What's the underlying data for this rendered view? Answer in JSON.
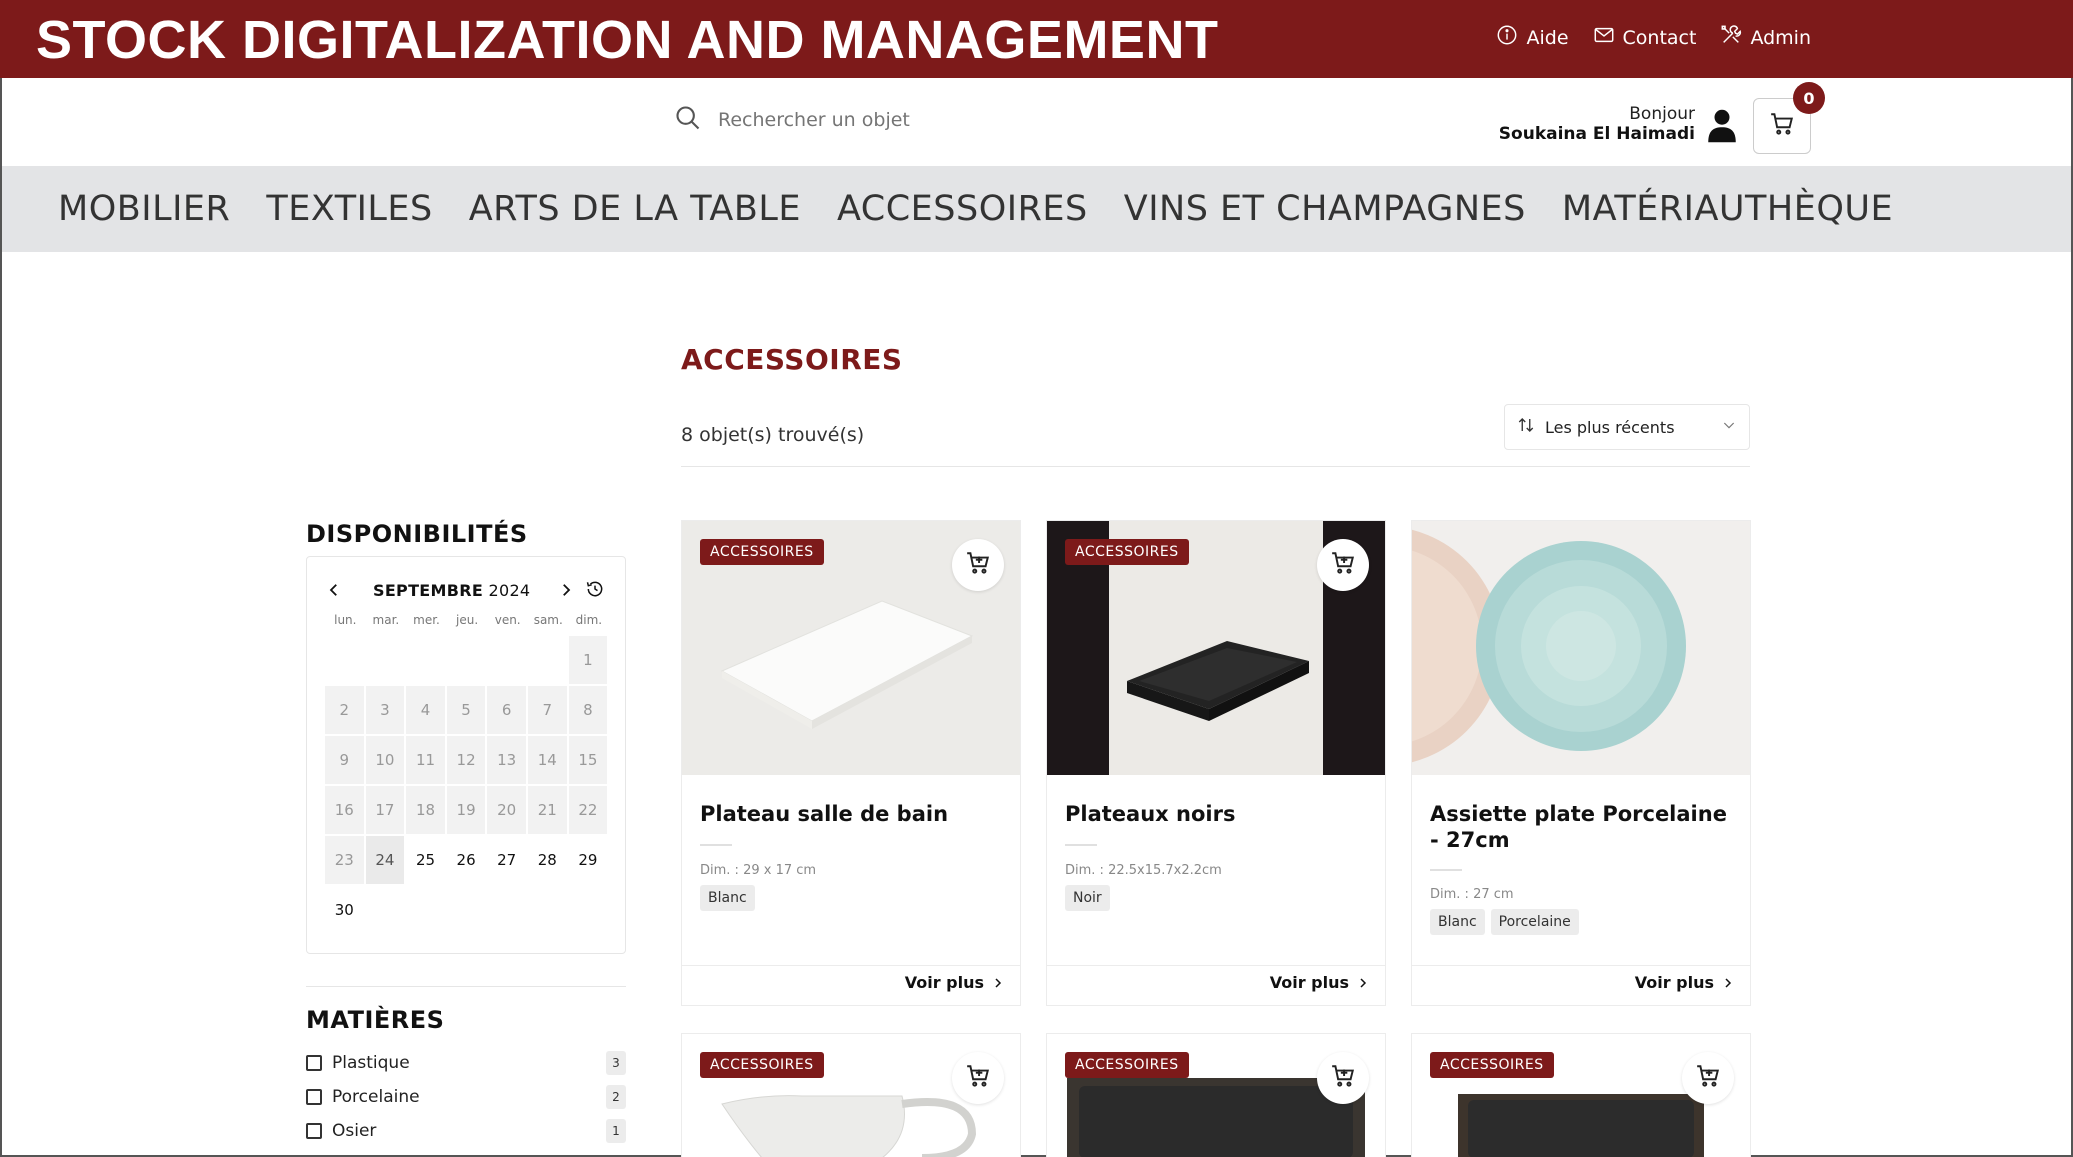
{
  "header": {
    "brand": "STOCK DIGITALIZATION AND MANAGEMENT",
    "links": [
      {
        "label": "Aide",
        "icon": "info-icon"
      },
      {
        "label": "Contact",
        "icon": "mail-icon"
      },
      {
        "label": "Admin",
        "icon": "tools-icon"
      }
    ]
  },
  "search": {
    "placeholder": "Rechercher un objet"
  },
  "user": {
    "greeting": "Bonjour",
    "name": "Soukaina El Haimadi"
  },
  "cart": {
    "count": "0"
  },
  "categories": [
    "MOBILIER",
    "TEXTILES",
    "ARTS DE LA TABLE",
    "ACCESSOIRES",
    "VINS ET CHAMPAGNES",
    "MATÉRIAUTHÈQUE"
  ],
  "main": {
    "title": "ACCESSOIRES",
    "count_text": "8 objet(s) trouvé(s)",
    "sort_label": "Les plus récents"
  },
  "sidebar": {
    "availability_title": "DISPONIBILITÉS",
    "calendar": {
      "month": "SEPTEMBRE",
      "year": "2024",
      "weekdays": [
        "lun.",
        "mar.",
        "mer.",
        "jeu.",
        "ven.",
        "sam.",
        "dim."
      ],
      "disabled_days": [
        "1",
        "2",
        "3",
        "4",
        "5",
        "6",
        "7",
        "8",
        "9",
        "10",
        "11",
        "12",
        "13",
        "14",
        "15",
        "16",
        "17",
        "18",
        "19",
        "20",
        "21",
        "22",
        "23"
      ],
      "today": "24",
      "available_days": [
        "25",
        "26",
        "27",
        "28",
        "29",
        "30"
      ]
    },
    "materials_title": "MATIÈRES",
    "materials": [
      {
        "label": "Plastique",
        "count": "3"
      },
      {
        "label": "Porcelaine",
        "count": "2"
      },
      {
        "label": "Osier",
        "count": "1"
      }
    ]
  },
  "products": [
    {
      "badge": "ACCESSOIRES",
      "title": "Plateau salle de bain",
      "dim": "Dim. : 29 x 17 cm",
      "tags": [
        "Blanc"
      ],
      "more": "Voir plus"
    },
    {
      "badge": "ACCESSOIRES",
      "title": "Plateaux noirs",
      "dim": "Dim. : 22.5x15.7x2.2cm",
      "tags": [
        "Noir"
      ],
      "more": "Voir plus"
    },
    {
      "badge": "ACCESSOIRES",
      "title": "Assiette plate Porcelaine - 27cm",
      "dim": "Dim. : 27 cm",
      "tags": [
        "Blanc",
        "Porcelaine"
      ],
      "more": "Voir plus"
    },
    {
      "badge": "ACCESSOIRES"
    },
    {
      "badge": "ACCESSOIRES"
    },
    {
      "badge": "ACCESSOIRES"
    }
  ],
  "colors": {
    "brand": "#7d1a1a",
    "nav_bg": "#e3e4e6"
  }
}
